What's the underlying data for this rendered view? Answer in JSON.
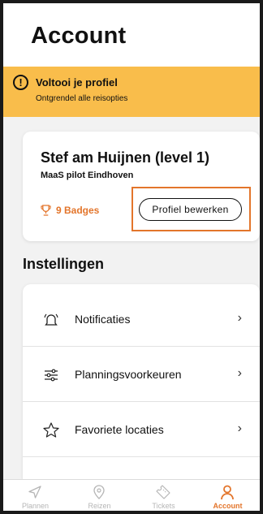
{
  "header": {
    "title": "Account"
  },
  "banner": {
    "title": "Voltooi je profiel",
    "subtitle": "Ontgrendel alle reisopties",
    "icon": "warning-icon",
    "color": "#f9bd4b"
  },
  "profile": {
    "name": "Stef am Huijnen (level 1)",
    "organization": "MaaS pilot Eindhoven",
    "badges_label": "9 Badges",
    "edit_button": "Profiel bewerken"
  },
  "settings": {
    "title": "Instellingen",
    "items": [
      {
        "label": "Notificaties",
        "icon": "bell-icon"
      },
      {
        "label": "Planningsvoorkeuren",
        "icon": "sliders-icon"
      },
      {
        "label": "Favoriete locaties",
        "icon": "star-icon"
      }
    ]
  },
  "tabbar": {
    "tabs": [
      {
        "label": "Plannen",
        "icon": "navigation-arrow-icon",
        "active": false
      },
      {
        "label": "Reizen",
        "icon": "location-pin-icon",
        "active": false
      },
      {
        "label": "Tickets",
        "icon": "ticket-icon",
        "active": false
      },
      {
        "label": "Account",
        "icon": "person-icon",
        "active": true
      }
    ]
  },
  "colors": {
    "accent": "#e3752b",
    "banner": "#f9bd4b",
    "background": "#f2f2f2"
  }
}
